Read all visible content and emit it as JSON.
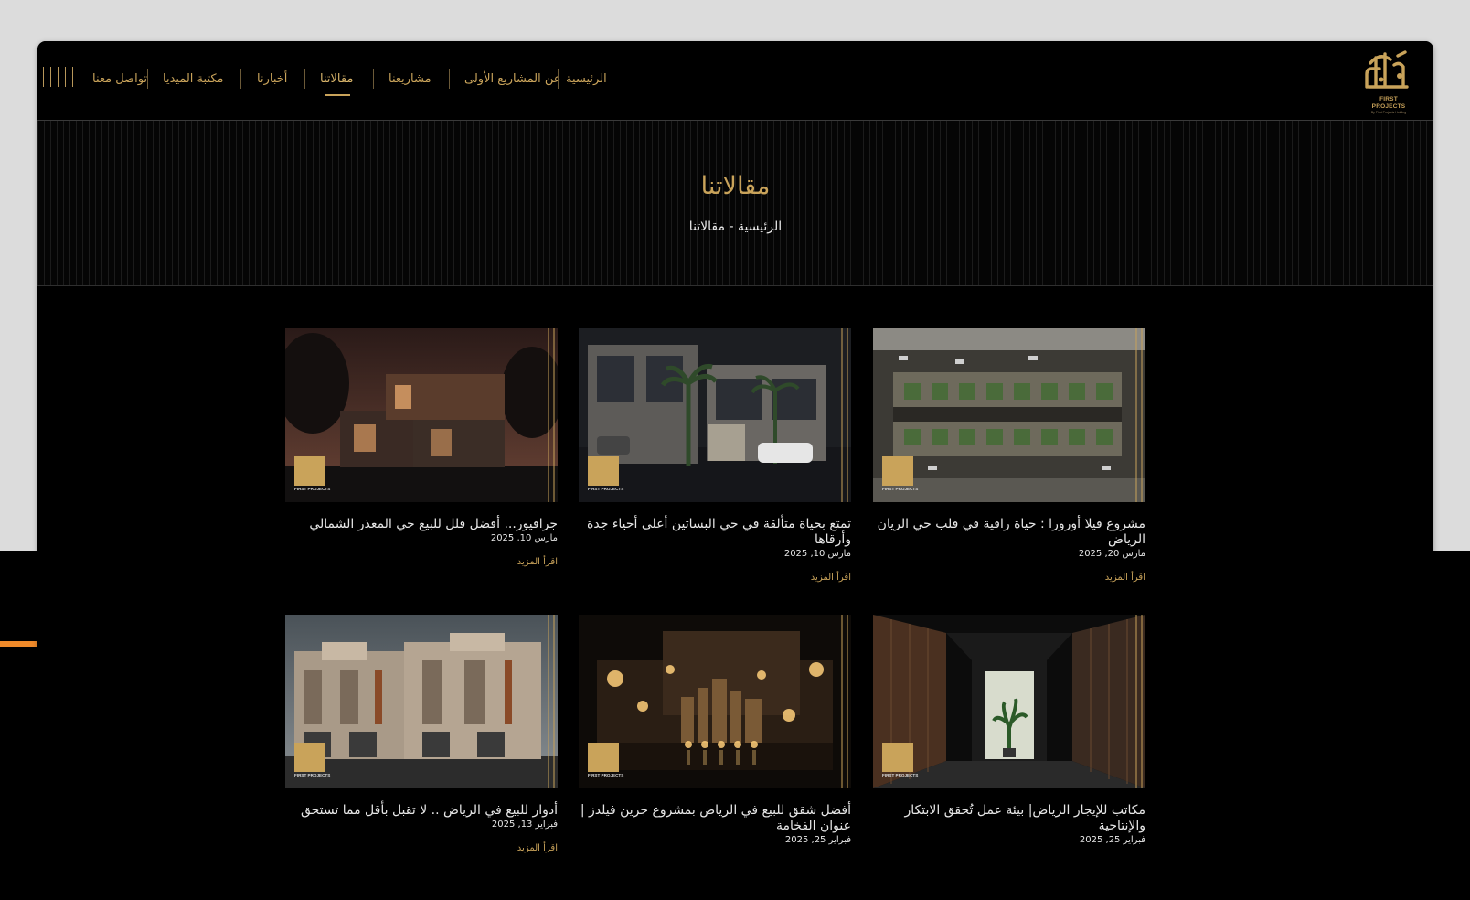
{
  "nav": {
    "items": [
      {
        "label": "الرئيسية",
        "active": false
      },
      {
        "label": "عن المشاريع الأولى",
        "active": false
      },
      {
        "label": "مشاريعنا",
        "active": false
      },
      {
        "label": "مقالاتنا",
        "active": true
      },
      {
        "label": "أخبارنا",
        "active": false
      },
      {
        "label": "مكتبة الميديا",
        "active": false
      },
      {
        "label": "تواصل معنا",
        "active": false
      }
    ],
    "menu_icon": "menu-bars-icon"
  },
  "logo": {
    "brand_en": "FIRST PROJECTS",
    "tagline": "By First Projects Holding",
    "color": "#c9a35a"
  },
  "hero": {
    "title": "مقالاتنا",
    "breadcrumb": "الرئيسية - مقالاتنا"
  },
  "cards": [
    {
      "title": "مشروع فيلا أورورا : حياة راقية في قلب حي الريان الرياض",
      "date": "مارس 20, 2025",
      "more": "اقرأ المزيد",
      "image": "aerial-villa-compound"
    },
    {
      "title": "تمتع بحياة متألقة في حي البساتين أعلى أحياء جدة وأرقاها",
      "date": "مارس 10, 2025",
      "more": "اقرأ المزيد",
      "image": "villa-with-palms"
    },
    {
      "title": "جرافيور... أفضل فلل للبيع حي المعذر الشمالي",
      "date": "مارس 10, 2025",
      "more": "اقرأ المزيد",
      "image": "modern-villa-dusk"
    },
    {
      "title": "مكاتب للإيجار الرياض| بيئة عمل تُحقق الابتكار والإنتاجية",
      "date": "فبراير 25, 2025",
      "more": "",
      "image": "office-corridor"
    },
    {
      "title": "أفضل شقق للبيع في الرياض بمشروع جرين فيلدز | عنوان الفخامة",
      "date": "فبراير 25, 2025",
      "more": "",
      "image": "city-lights-bokeh"
    },
    {
      "title": "أدوار للبيع في الرياض .. لا تقبل بأقل مما تستحق",
      "date": "فبراير 13, 2025",
      "more": "اقرأ المزيد",
      "image": "beige-townhouses"
    }
  ],
  "colors": {
    "gold": "#c9a35a",
    "background": "#000000",
    "text": "#e6e6e6"
  }
}
